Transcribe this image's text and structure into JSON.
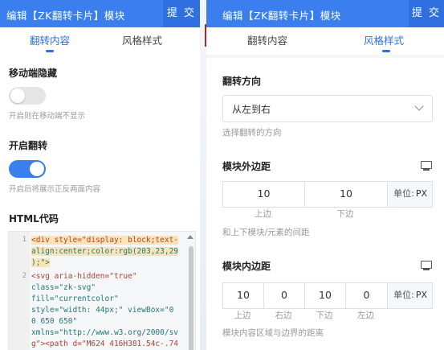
{
  "left": {
    "header_title": "编辑【ZK翻转卡片】模块",
    "submit_label": "提 交",
    "tabs": [
      "翻转内容",
      "风格样式"
    ],
    "mobile_hide": {
      "label": "移动端隐藏",
      "hint": "开启则在移动端不显示",
      "on": false
    },
    "flip": {
      "label": "开启翻转",
      "hint": "开启后将展示正反两面内容",
      "on": true
    },
    "html_code": {
      "label": "HTML代码",
      "line_numbers": [
        "1",
        "2"
      ],
      "lines": [
        "<div style=\"display: block;text-",
        "align:center;color:rgb(203,23,29",
        ");\">",
        "<svg aria-hidden=\"true\"",
        "class=\"zk-svg\"",
        "fill=\"currentcolor\"",
        "style=\"width: 44px;\" viewBox=\"0",
        "0 650 650\"",
        "xmlns=\"http://www.w3.org/2000/sv",
        "g\"><path d=\"M624 416H381.54c-.74"
      ]
    }
  },
  "right": {
    "header_title": "编辑【ZK翻转卡片】模块",
    "submit_label": "提 交",
    "tabs": [
      "翻转内容",
      "风格样式"
    ],
    "direction": {
      "label": "翻转方向",
      "value": "从左到右",
      "hint": "选择翻转的方向"
    },
    "margin": {
      "label": "模块外边距",
      "values": [
        "10",
        "10"
      ],
      "unit_label": "单位:",
      "unit": "PX",
      "sublabels": [
        "上边",
        "下边"
      ],
      "hint": "和上下模块/元素的间距"
    },
    "padding": {
      "label": "模块内边距",
      "values": [
        "10",
        "0",
        "10",
        "0"
      ],
      "unit_label": "单位:",
      "unit": "PX",
      "sublabels": [
        "上边",
        "右边",
        "下边",
        "左边"
      ],
      "hint": "模块内容区域与边界的距离"
    }
  },
  "colors": {
    "primary": "#3b7fee",
    "header_dark": "#2f6fe0",
    "text": "#222222",
    "hint": "#999999"
  }
}
